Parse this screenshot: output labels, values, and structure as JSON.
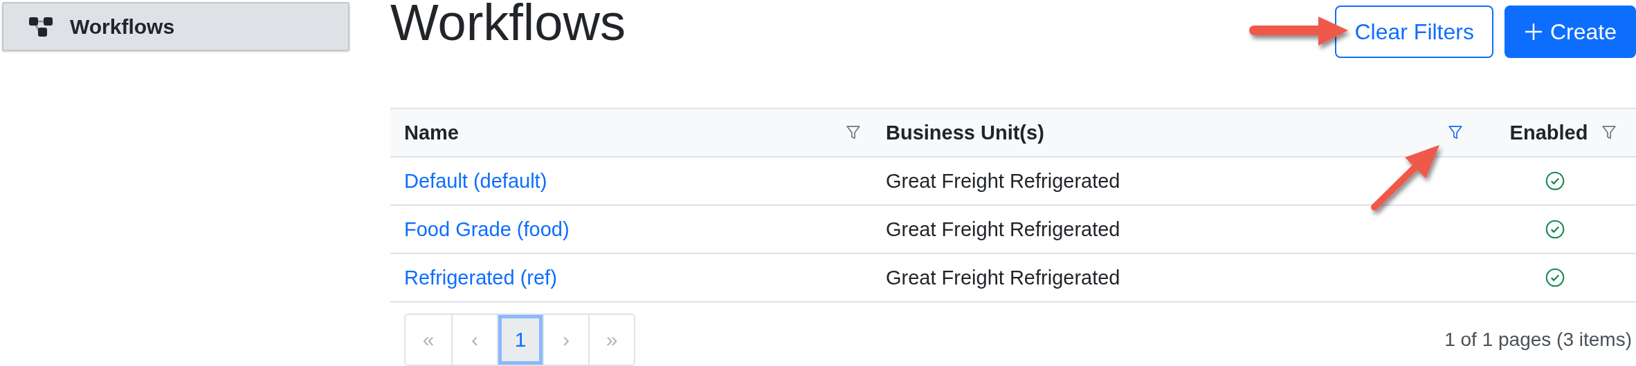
{
  "sidebar": {
    "items": [
      {
        "label": "Workflows",
        "selected": true
      }
    ]
  },
  "page": {
    "title": "Workflows"
  },
  "actions": [
    {
      "kind": "outline",
      "label": "Clear Filters"
    },
    {
      "kind": "primary",
      "label": "Create"
    }
  ],
  "table": {
    "columns": [
      {
        "label": "Name",
        "filtered": false,
        "kind": "text"
      },
      {
        "label": "Business Unit(s)",
        "filtered": true,
        "kind": "text"
      },
      {
        "label": "Enabled",
        "filtered": false,
        "kind": "status"
      }
    ],
    "rows": [
      {
        "name": "Default (default)",
        "business_units": "Great Freight Refrigerated",
        "enabled": true
      },
      {
        "name": "Food Grade (food)",
        "business_units": "Great Freight Refrigerated",
        "enabled": true
      },
      {
        "name": "Refrigerated (ref)",
        "business_units": "Great Freight Refrigerated",
        "enabled": true
      }
    ]
  },
  "pagination": {
    "buttons": [
      {
        "label": "«",
        "kind": "nav",
        "selected": false
      },
      {
        "label": "‹",
        "kind": "nav",
        "selected": false
      },
      {
        "label": "1",
        "kind": "page",
        "selected": true
      },
      {
        "label": "›",
        "kind": "nav",
        "selected": false
      },
      {
        "label": "»",
        "kind": "nav",
        "selected": false
      }
    ],
    "summary": "1 of 1 pages (3 items)"
  }
}
